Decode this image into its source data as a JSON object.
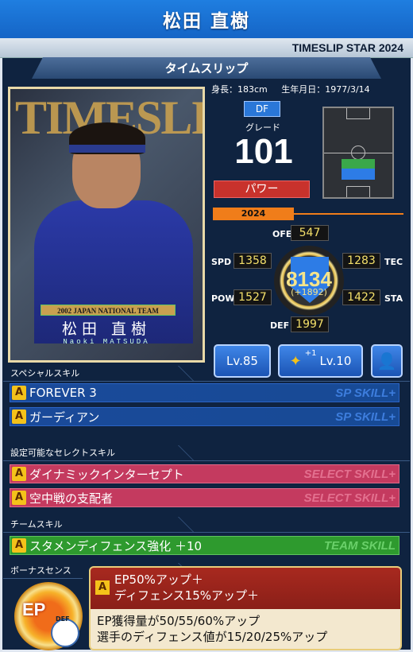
{
  "header": {
    "player_name": "松田 直樹",
    "series": "TIMESLIP STAR 2024",
    "ribbon": "タイムスリップ"
  },
  "card": {
    "bg_text": "TIMESLIP",
    "team_label": "2002 JAPAN NATIONAL TEAM",
    "name_jp": "松田 直樹",
    "name_roman": "Naoki MATSUDA"
  },
  "profile": {
    "height": "身長：183cm",
    "birthdate": "生年月日：1977/3/14",
    "position": "DF",
    "grade_label": "グレード",
    "grade": "101",
    "type": "パワー"
  },
  "stats": {
    "year": "2024",
    "ofe_label": "OFE",
    "ofe": "547",
    "spd_label": "SPD",
    "spd": "1358",
    "tec_label": "TEC",
    "tec": "1283",
    "pow_label": "POW",
    "pow": "1527",
    "sta_label": "STA",
    "sta": "1422",
    "def_label": "DEF",
    "def": "1997",
    "total": "8134",
    "total_bonus": "(+1892)"
  },
  "buttons": {
    "level": "Lv.85",
    "skill_level_plus": "+1",
    "skill_level": "Lv.10"
  },
  "special_skills": {
    "title": "スペシャルスキル",
    "tag": "SP SKILL+",
    "items": [
      {
        "rank": "A",
        "name": "FOREVER 3"
      },
      {
        "rank": "A",
        "name": "ガーディアン"
      }
    ]
  },
  "select_skills": {
    "title": "設定可能なセレクトスキル",
    "tag": "SELECT SKILL+",
    "items": [
      {
        "rank": "A",
        "name": "ダイナミックインターセプト"
      },
      {
        "rank": "A",
        "name": "空中戦の支配者"
      }
    ]
  },
  "team_skills": {
    "title": "チームスキル",
    "tag": "TEAM SKILL",
    "items": [
      {
        "rank": "A",
        "name": "スタメンディフェンス強化 ＋10"
      }
    ]
  },
  "bonus_sense": {
    "title": "ボーナスセンス",
    "emblem_text": "EP",
    "emblem_sub": "DEF",
    "rank": "A",
    "line1": "EP50%アップ＋",
    "line2": "ディフェンス15%アップ＋",
    "desc1": "EP獲得量が50/55/60%アップ",
    "desc2": "選手のディフェンス値が15/20/25%アップ"
  },
  "colors": {
    "header": "#1a74dc",
    "sp": "#174a95",
    "select": "#c43a5f",
    "team": "#2e9a2e",
    "accent": "#f07d1a"
  }
}
